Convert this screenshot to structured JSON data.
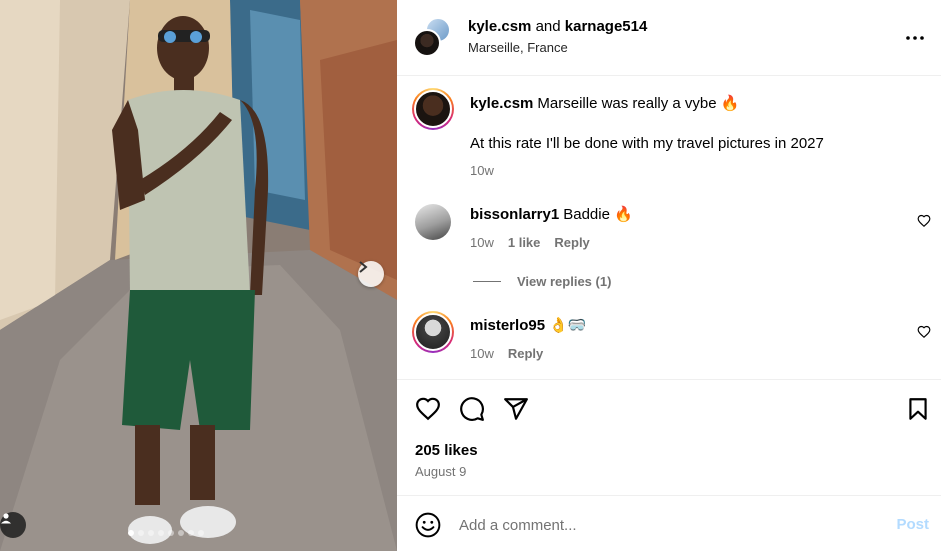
{
  "header": {
    "author": "kyle.csm",
    "conjunction": "and",
    "coauthor": "karnage514",
    "location": "Marseille, France"
  },
  "caption": {
    "user": "kyle.csm",
    "text": "Marseille was really a vybe 🔥",
    "second_line": "At this rate I'll be done with my travel pictures in 2027",
    "time": "10w"
  },
  "comments": [
    {
      "user": "bissonlarry1",
      "text": "Baddie 🔥",
      "time": "10w",
      "likes": "1 like",
      "reply_label": "Reply",
      "view_replies": "View replies (1)"
    },
    {
      "user": "misterlo95",
      "text": "👌🥽",
      "time": "10w",
      "reply_label": "Reply"
    }
  ],
  "stats": {
    "likes": "205 likes",
    "date": "August 9"
  },
  "add_comment": {
    "placeholder": "Add a comment...",
    "post_label": "Post"
  },
  "carousel": {
    "total_slides": 8,
    "active_slide": 1
  },
  "colors": {
    "post_button_disabled": "#b3dbff",
    "secondary_text": "#737373",
    "divider": "#efefef"
  }
}
